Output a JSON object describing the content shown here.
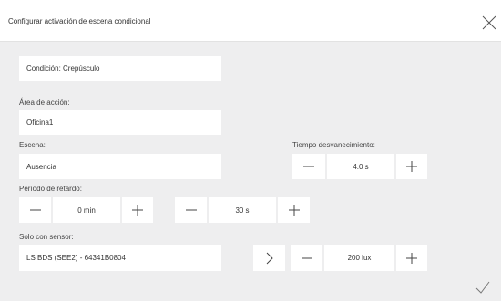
{
  "dialog": {
    "title": "Configurar activación de escena condicional",
    "close_icon": "close-icon",
    "confirm_icon": "checkmark-icon"
  },
  "condition": {
    "value": "Condición: Crepúsculo"
  },
  "action_area": {
    "label": "Área de acción:",
    "value": "Oficina1"
  },
  "scene": {
    "label": "Escena:",
    "value": "Ausencia"
  },
  "fade_time": {
    "label": "Tiempo desvanecimiento:",
    "value": "4.0 s"
  },
  "delay": {
    "label": "Período de retardo:",
    "minutes": "0 min",
    "seconds": "30 s"
  },
  "sensor": {
    "label": "Solo con sensor:",
    "value": "LS BDS (SEE2) - 64341B0804",
    "lux": "200 lux"
  },
  "colors": {
    "background": "#eeeeef",
    "panel": "#ffffff",
    "text": "#333333",
    "icon": "#555555"
  }
}
